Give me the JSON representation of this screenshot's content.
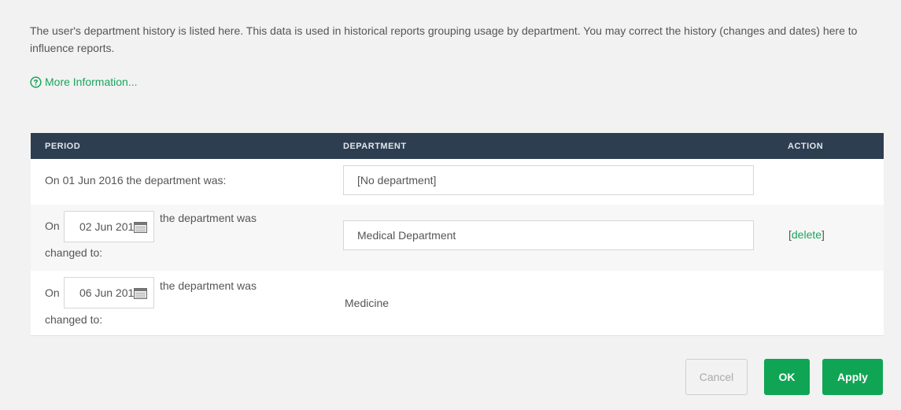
{
  "intro": {
    "text": "The user's department history is listed here. This data is used in historical reports grouping usage by department. You may correct the history (changes and dates) here to influence reports.",
    "more_info": "More Information..."
  },
  "table": {
    "headers": {
      "period": "PERIOD",
      "department": "DEPARTMENT",
      "action": "ACTION"
    },
    "rows": [
      {
        "period_text": "On 01 Jun 2016 the department was:",
        "department": "[No department]"
      },
      {
        "on": "On",
        "date": "02 Jun 2016",
        "changed_1": "the department was",
        "changed_2": "changed to:",
        "department": "Medical Department",
        "action_open": "[",
        "action": "delete",
        "action_close": "]"
      },
      {
        "on": "On",
        "date": "06 Jun 2016",
        "changed_1": "the department was",
        "changed_2": "changed to:",
        "department": "Medicine"
      }
    ]
  },
  "buttons": {
    "cancel": "Cancel",
    "ok": "OK",
    "apply": "Apply"
  },
  "colors": {
    "accent": "#10a554",
    "header_bg": "#2d3e50",
    "link": "#1aa55a"
  }
}
